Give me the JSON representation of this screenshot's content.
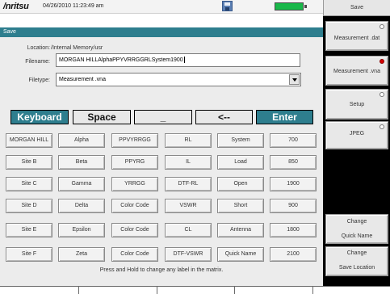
{
  "status_bar": {
    "brand": "/nritsu",
    "datetime": "04/26/2010 11:23:49 am"
  },
  "dialog": {
    "title": "Save",
    "location_label": "Location:",
    "location_value": "/Internal Memory/usr",
    "filename_label": "Filename:",
    "filename_value": "MORGAN HILLAlphaPPYVRRGGRLSystem1900",
    "filetype_label": "Filetype:",
    "filetype_value": "Measurement .vna"
  },
  "keyboard_row": {
    "keyboard": "Keyboard",
    "space": "Space",
    "underscore": "_",
    "backspace": "<--",
    "enter": "Enter"
  },
  "matrix": [
    [
      "MORGAN HILL",
      "Alpha",
      "PPVYRRGG",
      "RL",
      "System",
      "700"
    ],
    [
      "Site B",
      "Beta",
      "PPYRG",
      "IL",
      "Load",
      "850"
    ],
    [
      "Site C",
      "Gamma",
      "YRRGG",
      "DTF-RL",
      "Open",
      "1900"
    ],
    [
      "Site D",
      "Delta",
      "Color Code",
      "VSWR",
      "Short",
      "900"
    ],
    [
      "Site E",
      "Epsilon",
      "Color Code",
      "CL",
      "Antenna",
      "1800"
    ],
    [
      "Site F",
      "Zeta",
      "Color Code",
      "DTF-VSWR",
      "Quick Name",
      "2100"
    ]
  ],
  "hint": "Press and Hold to change any label in the matrix.",
  "side_menu": {
    "title": "Save",
    "items": [
      {
        "label": "Measurement .dat",
        "selected": false
      },
      {
        "label": "Measurement .vna",
        "selected": true
      },
      {
        "label": "Setup",
        "selected": false
      },
      {
        "label": "JPEG",
        "selected": false
      }
    ],
    "change_quick_name": {
      "line1": "Change",
      "line2": "Quick Name"
    },
    "change_save_location": {
      "line1": "Change",
      "line2": "Save Location"
    }
  },
  "colors": {
    "accent_teal": "#2e7e8e",
    "battery_green": "#19b84a",
    "selected_indicator": "#d60000"
  }
}
